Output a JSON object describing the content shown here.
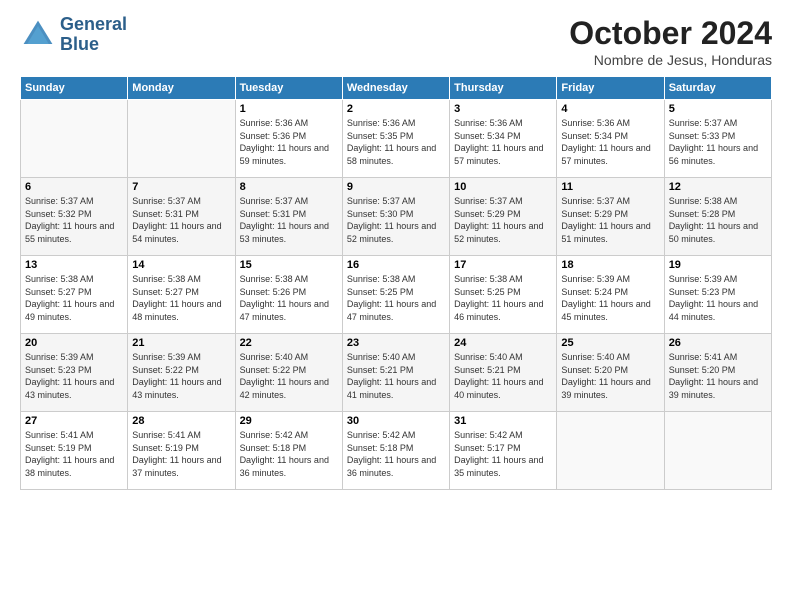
{
  "header": {
    "logo_line1": "General",
    "logo_line2": "Blue",
    "month_title": "October 2024",
    "location": "Nombre de Jesus, Honduras"
  },
  "weekdays": [
    "Sunday",
    "Monday",
    "Tuesday",
    "Wednesday",
    "Thursday",
    "Friday",
    "Saturday"
  ],
  "weeks": [
    [
      null,
      null,
      {
        "day": 1,
        "sunrise": "5:36 AM",
        "sunset": "5:36 PM",
        "daylight": "11 hours and 59 minutes."
      },
      {
        "day": 2,
        "sunrise": "5:36 AM",
        "sunset": "5:35 PM",
        "daylight": "11 hours and 58 minutes."
      },
      {
        "day": 3,
        "sunrise": "5:36 AM",
        "sunset": "5:34 PM",
        "daylight": "11 hours and 57 minutes."
      },
      {
        "day": 4,
        "sunrise": "5:36 AM",
        "sunset": "5:34 PM",
        "daylight": "11 hours and 57 minutes."
      },
      {
        "day": 5,
        "sunrise": "5:37 AM",
        "sunset": "5:33 PM",
        "daylight": "11 hours and 56 minutes."
      }
    ],
    [
      {
        "day": 6,
        "sunrise": "5:37 AM",
        "sunset": "5:32 PM",
        "daylight": "11 hours and 55 minutes."
      },
      {
        "day": 7,
        "sunrise": "5:37 AM",
        "sunset": "5:31 PM",
        "daylight": "11 hours and 54 minutes."
      },
      {
        "day": 8,
        "sunrise": "5:37 AM",
        "sunset": "5:31 PM",
        "daylight": "11 hours and 53 minutes."
      },
      {
        "day": 9,
        "sunrise": "5:37 AM",
        "sunset": "5:30 PM",
        "daylight": "11 hours and 52 minutes."
      },
      {
        "day": 10,
        "sunrise": "5:37 AM",
        "sunset": "5:29 PM",
        "daylight": "11 hours and 52 minutes."
      },
      {
        "day": 11,
        "sunrise": "5:37 AM",
        "sunset": "5:29 PM",
        "daylight": "11 hours and 51 minutes."
      },
      {
        "day": 12,
        "sunrise": "5:38 AM",
        "sunset": "5:28 PM",
        "daylight": "11 hours and 50 minutes."
      }
    ],
    [
      {
        "day": 13,
        "sunrise": "5:38 AM",
        "sunset": "5:27 PM",
        "daylight": "11 hours and 49 minutes."
      },
      {
        "day": 14,
        "sunrise": "5:38 AM",
        "sunset": "5:27 PM",
        "daylight": "11 hours and 48 minutes."
      },
      {
        "day": 15,
        "sunrise": "5:38 AM",
        "sunset": "5:26 PM",
        "daylight": "11 hours and 47 minutes."
      },
      {
        "day": 16,
        "sunrise": "5:38 AM",
        "sunset": "5:25 PM",
        "daylight": "11 hours and 47 minutes."
      },
      {
        "day": 17,
        "sunrise": "5:38 AM",
        "sunset": "5:25 PM",
        "daylight": "11 hours and 46 minutes."
      },
      {
        "day": 18,
        "sunrise": "5:39 AM",
        "sunset": "5:24 PM",
        "daylight": "11 hours and 45 minutes."
      },
      {
        "day": 19,
        "sunrise": "5:39 AM",
        "sunset": "5:23 PM",
        "daylight": "11 hours and 44 minutes."
      }
    ],
    [
      {
        "day": 20,
        "sunrise": "5:39 AM",
        "sunset": "5:23 PM",
        "daylight": "11 hours and 43 minutes."
      },
      {
        "day": 21,
        "sunrise": "5:39 AM",
        "sunset": "5:22 PM",
        "daylight": "11 hours and 43 minutes."
      },
      {
        "day": 22,
        "sunrise": "5:40 AM",
        "sunset": "5:22 PM",
        "daylight": "11 hours and 42 minutes."
      },
      {
        "day": 23,
        "sunrise": "5:40 AM",
        "sunset": "5:21 PM",
        "daylight": "11 hours and 41 minutes."
      },
      {
        "day": 24,
        "sunrise": "5:40 AM",
        "sunset": "5:21 PM",
        "daylight": "11 hours and 40 minutes."
      },
      {
        "day": 25,
        "sunrise": "5:40 AM",
        "sunset": "5:20 PM",
        "daylight": "11 hours and 39 minutes."
      },
      {
        "day": 26,
        "sunrise": "5:41 AM",
        "sunset": "5:20 PM",
        "daylight": "11 hours and 39 minutes."
      }
    ],
    [
      {
        "day": 27,
        "sunrise": "5:41 AM",
        "sunset": "5:19 PM",
        "daylight": "11 hours and 38 minutes."
      },
      {
        "day": 28,
        "sunrise": "5:41 AM",
        "sunset": "5:19 PM",
        "daylight": "11 hours and 37 minutes."
      },
      {
        "day": 29,
        "sunrise": "5:42 AM",
        "sunset": "5:18 PM",
        "daylight": "11 hours and 36 minutes."
      },
      {
        "day": 30,
        "sunrise": "5:42 AM",
        "sunset": "5:18 PM",
        "daylight": "11 hours and 36 minutes."
      },
      {
        "day": 31,
        "sunrise": "5:42 AM",
        "sunset": "5:17 PM",
        "daylight": "11 hours and 35 minutes."
      },
      null,
      null
    ]
  ]
}
